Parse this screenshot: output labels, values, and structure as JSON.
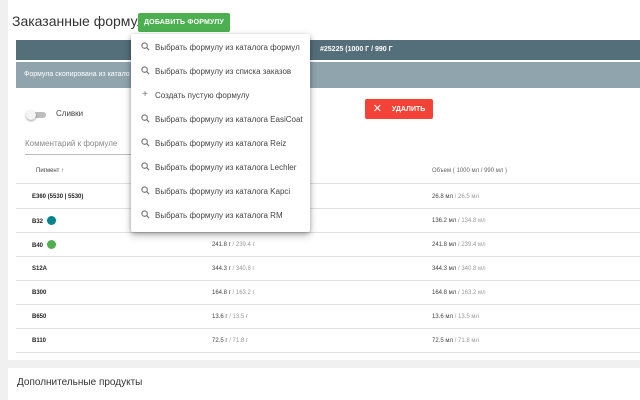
{
  "header": {
    "title": "Заказанные формулы",
    "add_button": "ДОБАВИТЬ ФОРМУЛУ"
  },
  "formula_bar": {
    "text": "#25225 (1000 Г / 990 Г"
  },
  "copied_bar": {
    "text": "Формула скопирована из катало"
  },
  "toggle": {
    "label": "Сливки",
    "on": false
  },
  "delete_button": {
    "label": "УДАЛИТЬ"
  },
  "comment": {
    "placeholder": "Комментарий к формуле"
  },
  "table": {
    "headers": {
      "pigment": "Пигмент ↑",
      "volume": "Объем ( 1000 мл / 990 мл )"
    },
    "rows": [
      {
        "pigment": "E360 (5530 | 5530)",
        "color": "",
        "weight": "",
        "weight_muted": "",
        "volume": "26.8 мл",
        "volume_muted": " / 26.5 мл"
      },
      {
        "pigment": "B32",
        "color": "#00838f",
        "weight": "",
        "weight_muted": "",
        "volume": "136.2 мл",
        "volume_muted": " / 134.8 мл"
      },
      {
        "pigment": "B40",
        "color": "#4caf50",
        "weight": "241.8 г",
        "weight_muted": " / 239.4 г",
        "volume": "241.8 мл",
        "volume_muted": " / 239.4 мл"
      },
      {
        "pigment": "S12A",
        "color": "",
        "weight": "344.3 г",
        "weight_muted": " / 340.8 г",
        "volume": "344.3 мл",
        "volume_muted": " / 340.8 мл"
      },
      {
        "pigment": "B300",
        "color": "",
        "weight": "164.8 г",
        "weight_muted": " / 163.2 г",
        "volume": "164.8 мл",
        "volume_muted": " / 163.2 мл"
      },
      {
        "pigment": "B650",
        "color": "",
        "weight": "13.6 г",
        "weight_muted": " / 13.5 г",
        "volume": "13.6 мл",
        "volume_muted": " / 13.5 мл"
      },
      {
        "pigment": "B110",
        "color": "",
        "weight": "72.5 г",
        "weight_muted": " / 71.8 г",
        "volume": "72.5 мл",
        "volume_muted": " / 71.8 мл"
      }
    ]
  },
  "extra_products": {
    "title": "Дополнительные продукты"
  },
  "menu": {
    "items": [
      {
        "icon": "search-icon",
        "label": "Выбрать формулу из каталога формул"
      },
      {
        "icon": "search-icon",
        "label": "Выбрать формулу из списка заказов"
      },
      {
        "icon": "plus-icon",
        "label": "Создать пустую формулу"
      },
      {
        "icon": "search-icon",
        "label": "Выбрать формулу из каталога EasiCoat"
      },
      {
        "icon": "search-icon",
        "label": "Выбрать формулу из каталога Reiz"
      },
      {
        "icon": "search-icon",
        "label": "Выбрать формулу из каталога Lechler"
      },
      {
        "icon": "search-icon",
        "label": "Выбрать формулу из каталога Kapci"
      },
      {
        "icon": "search-icon",
        "label": "Выбрать формулу из каталога RM"
      }
    ]
  }
}
